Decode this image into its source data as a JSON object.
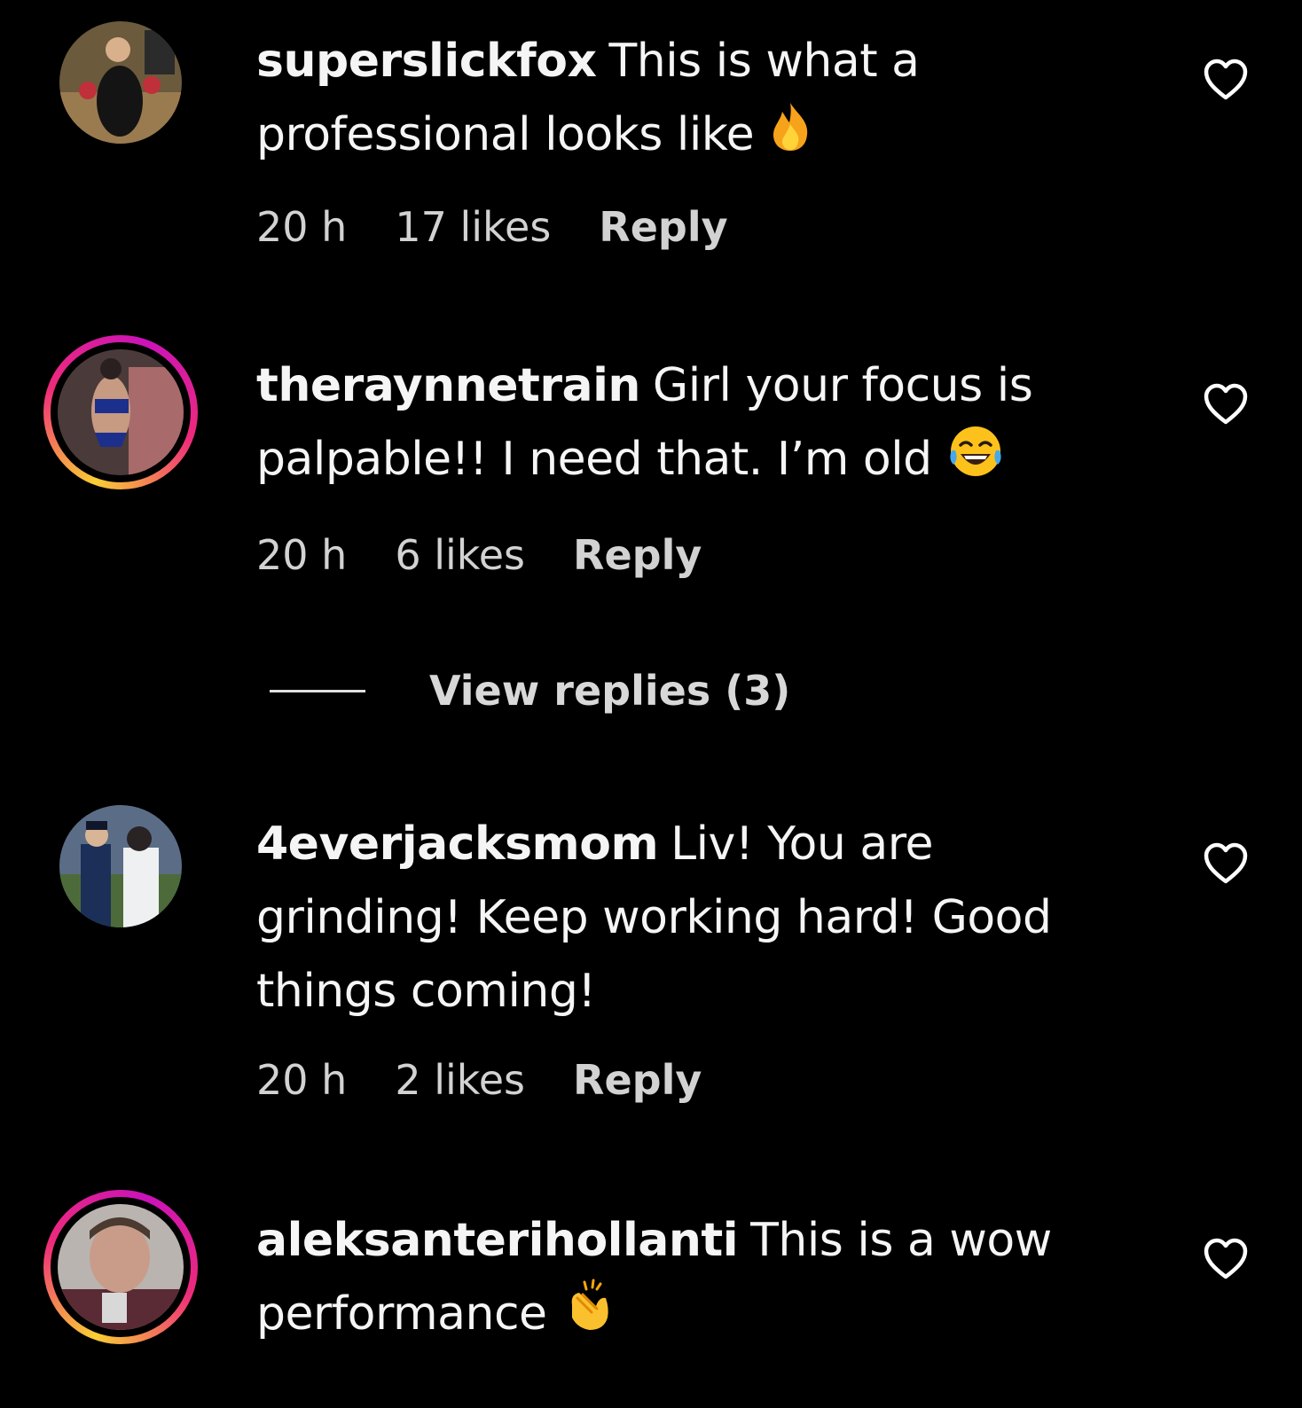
{
  "comments": [
    {
      "username": "superslickfox",
      "text": "This is what a professional looks like",
      "emoji": "fire-emoji",
      "time": "20 h",
      "likes": "17 likes",
      "reply": "Reply",
      "has_story_ring": false
    },
    {
      "username": "theraynnetrain",
      "text": "Girl your focus is palpable!! I need that. I’m old",
      "emoji": "face-with-tears-of-joy-emoji",
      "time": "20 h",
      "likes": "6 likes",
      "reply": "Reply",
      "has_story_ring": true,
      "view_replies": "View replies (3)"
    },
    {
      "username": "4everjacksmom",
      "text": "Liv! You are grinding! Keep working hard! Good things coming!",
      "time": "20 h",
      "likes": "2 likes",
      "reply": "Reply",
      "has_story_ring": false
    },
    {
      "username": "aleksanterihollanti",
      "text": "This is a wow performance",
      "emoji": "clapping-hands-emoji",
      "has_story_ring": true
    }
  ],
  "icons": {
    "like": "heart-outline-icon"
  },
  "colors": {
    "background": "#000000",
    "text": "#f5f5f5",
    "meta": "#d2d2d2",
    "ring_start": "#f9ce34",
    "ring_mid": "#ee2a7b"
  }
}
